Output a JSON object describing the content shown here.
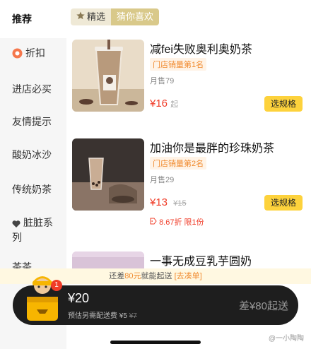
{
  "sidebar": {
    "items": [
      {
        "label": "推荐"
      },
      {
        "label": "折扣"
      },
      {
        "label": "进店必买"
      },
      {
        "label": "友情提示"
      },
      {
        "label": "酸奶冰沙"
      },
      {
        "label": "传统奶茶"
      },
      {
        "label": "脏脏系",
        "label2": "列"
      },
      {
        "label": "茶茶"
      }
    ]
  },
  "filters": {
    "selected": "精选",
    "secondary": "猜你喜欢"
  },
  "products": [
    {
      "name": "减fei失败奥利奥奶茶",
      "tag": "门店销量第1名",
      "sales": "月售79",
      "price": "¥16",
      "price_suffix": "起",
      "button": "选规格"
    },
    {
      "name": "加油你是最胖的珍珠奶茶",
      "tag": "门店销量第2名",
      "sales": "月售29",
      "price": "¥13",
      "original_price": "¥15",
      "discount": "8.67折 限1份",
      "button": "选规格"
    },
    {
      "name": "一事无成豆乳芋圆奶"
    }
  ],
  "min_order": {
    "prefix": "还差",
    "amount": "80元",
    "suffix": "就能起送",
    "link": "[去凑单]"
  },
  "cart": {
    "badge": "1",
    "total": "¥20",
    "fee_prefix": "预估另需配送费 ¥5",
    "fee_original": "¥7",
    "need": "差¥80起送"
  },
  "watermark": "@一小陶陶",
  "colors": {
    "accent": "#fdd23c",
    "price": "#f03c28",
    "tag": "#f08a2e",
    "cart_bg": "#1e1e1e"
  }
}
